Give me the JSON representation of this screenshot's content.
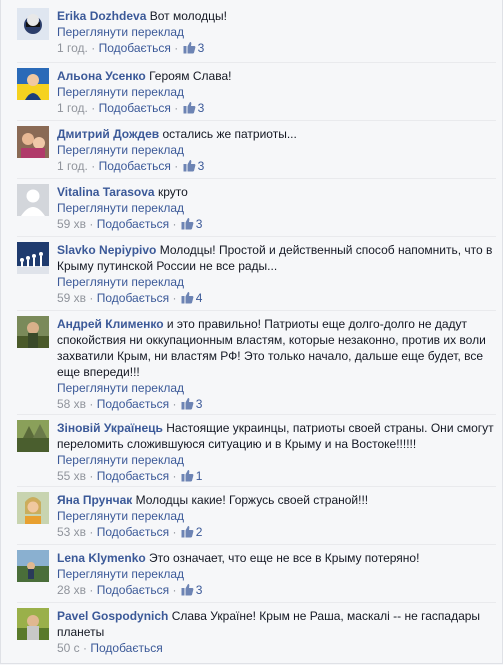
{
  "ui": {
    "translate_label": "Переглянути переклад",
    "like_label": "Подобається",
    "dot": "·"
  },
  "comments": [
    {
      "author": "Erika Dozhdeva",
      "text": "Вот молодцы!",
      "time": "1 год.",
      "likes": "3",
      "avatar_color": "#3a4f8a"
    },
    {
      "author": "Альона Усенко",
      "text": "Героям Слава!",
      "time": "1 год.",
      "likes": "3",
      "avatar_color": "#2a6ab8"
    },
    {
      "author": "Дмитрий Дождев",
      "text": "остались же патриоты...",
      "time": "1 год.",
      "likes": "3",
      "avatar_color": "#6b4a3a"
    },
    {
      "author": "Vitalina Tarasova",
      "text": "круто",
      "time": "59 хв",
      "likes": "3",
      "avatar_color": "#c9ccd4"
    },
    {
      "author": "Slavko Nepiypivo",
      "text": "Молодцы! Простой и действенный способ напомнить, что в Крыму путинской России не все рады...",
      "time": "59 хв",
      "likes": "4",
      "avatar_color": "#1f3b6e"
    },
    {
      "author": "Андрей Клименко",
      "text": "и это правильно! Патриоты еще долго-долго не дадут спокойствия ни оккупационным властям, которые незаконно, против их воли захватили Крым, ни властям РФ! Это только начало, дальше еще будет, все еще впереди!!!",
      "time": "58 хв",
      "likes": "3",
      "avatar_color": "#5e6b3a"
    },
    {
      "author": "Зіновій Українець",
      "text": "Настоящие украинцы, патриоты своей страны. Они смогут переломить сложившуюся ситуацию и в Крыму и на Востоке!!!!!!",
      "time": "55 хв",
      "likes": "1",
      "avatar_color": "#4a5e2e"
    },
    {
      "author": "Яна Прунчак",
      "text": "Молодцы какие! Горжусь своей страной!!!",
      "time": "53 хв",
      "likes": "2",
      "avatar_color": "#c8a44a"
    },
    {
      "author": "Lena Klymenko",
      "text": "Это означает, что еще не все в Крыму потеряно!",
      "time": "28 хв",
      "likes": "3",
      "avatar_color": "#4a6e8a"
    },
    {
      "author": "Pavel Gospodynich",
      "text": "Слава Україне! Крым не Раша, маскалі -- не гаспадары планеты",
      "time": "50 с",
      "likes": "",
      "avatar_color": "#7a8a3a"
    }
  ]
}
